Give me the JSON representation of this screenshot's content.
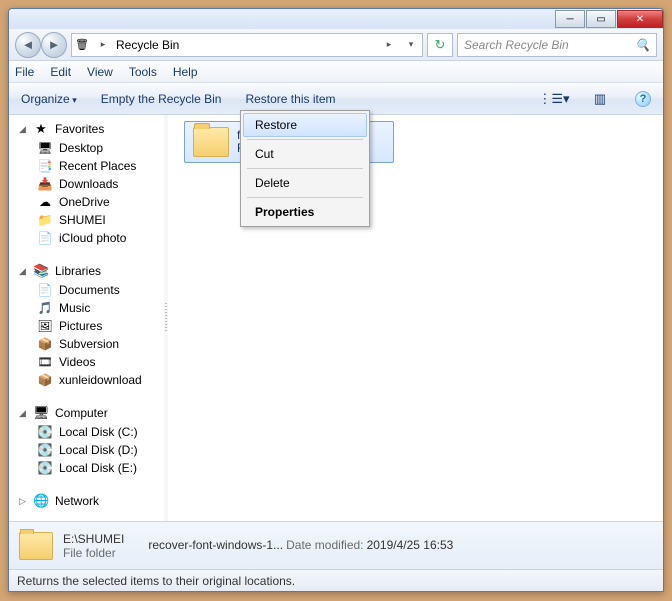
{
  "title": "Recycle Bin",
  "breadcrumb_arrow": "▸",
  "search": {
    "placeholder": "Search Recycle Bin"
  },
  "menus": [
    "File",
    "Edit",
    "View",
    "Tools",
    "Help"
  ],
  "toolbar": {
    "organize": "Organize",
    "empty": "Empty the Recycle Bin",
    "restore": "Restore this item"
  },
  "sidebar": {
    "favorites": {
      "label": "Favorites",
      "items": [
        {
          "icon": "🖥",
          "label": "Desktop"
        },
        {
          "icon": "📑",
          "label": "Recent Places"
        },
        {
          "icon": "📥",
          "label": "Downloads"
        },
        {
          "icon": "☁",
          "label": "OneDrive"
        },
        {
          "icon": "📁",
          "label": "SHUMEI"
        },
        {
          "icon": "📄",
          "label": "iCloud photo"
        }
      ]
    },
    "libraries": {
      "label": "Libraries",
      "items": [
        {
          "icon": "📄",
          "label": "Documents"
        },
        {
          "icon": "🎵",
          "label": "Music"
        },
        {
          "icon": "🖼",
          "label": "Pictures"
        },
        {
          "icon": "📦",
          "label": "Subversion"
        },
        {
          "icon": "🎞",
          "label": "Videos"
        },
        {
          "icon": "📦",
          "label": "xunleidownload"
        }
      ]
    },
    "computer": {
      "label": "Computer",
      "items": [
        {
          "icon": "💽",
          "label": "Local Disk (C:)"
        },
        {
          "icon": "💽",
          "label": "Local Disk (D:)"
        },
        {
          "icon": "💽",
          "label": "Local Disk (E:)"
        }
      ]
    },
    "network": {
      "label": "Network"
    }
  },
  "file": {
    "name_short": "f",
    "second_line": "F"
  },
  "context": {
    "restore": "Restore",
    "cut": "Cut",
    "delete": "Delete",
    "properties": "Properties"
  },
  "details": {
    "path": "E:\\SHUMEI",
    "type": "File folder",
    "name_trunc": "recover-font-windows-1...",
    "mod_label": "Date modified:",
    "mod_value": "2019/4/25 16:53"
  },
  "status": "Returns the selected items to their original locations."
}
